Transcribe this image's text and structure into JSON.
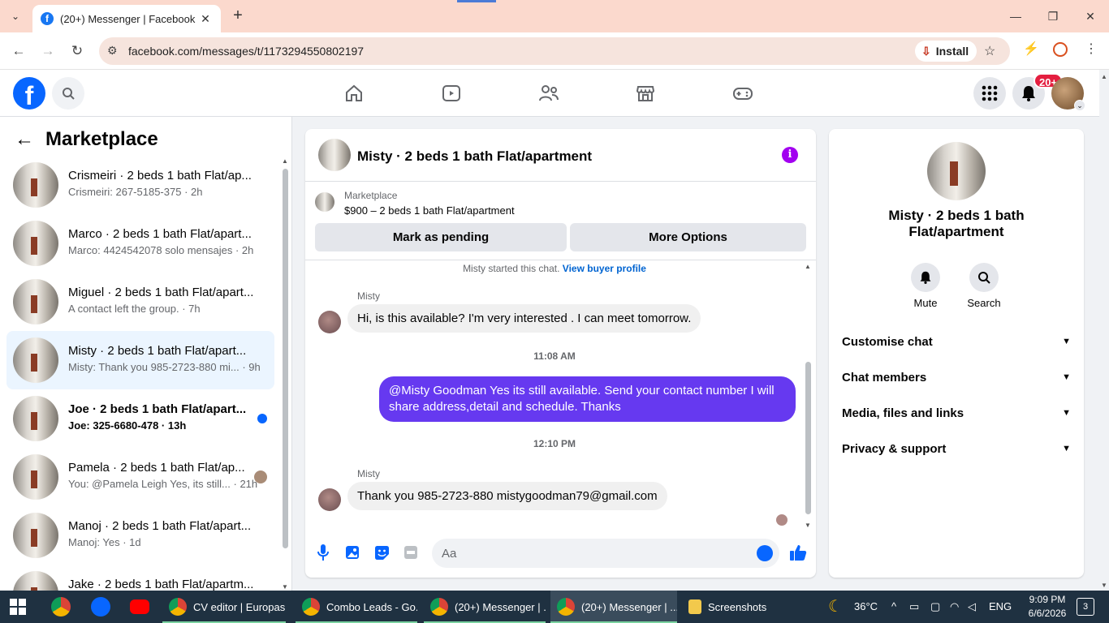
{
  "browser": {
    "tab_title": "(20+) Messenger | Facebook",
    "url": "facebook.com/messages/t/1173294550802197",
    "install_label": "Install"
  },
  "fb": {
    "notification_count": "20+"
  },
  "left": {
    "title": "Marketplace",
    "chats": [
      {
        "name": "Crismeiri · 2 beds 1 bath Flat/ap...",
        "preview": "Crismeiri: 267-5185-375 · 2h"
      },
      {
        "name": "Marco · 2 beds 1 bath Flat/apart...",
        "preview": "Marco: 4424542078 solo mensajes · 2h"
      },
      {
        "name": "Miguel · 2 beds 1 bath Flat/apart...",
        "preview": "A contact left the group. · 7h"
      },
      {
        "name": "Misty · 2 beds 1 bath Flat/apart...",
        "preview": "Misty: Thank you 985-2723-880 mi... · 9h"
      },
      {
        "name": "Joe · 2 beds 1 bath Flat/apart...",
        "preview": "Joe: 325-6680-478 · 13h"
      },
      {
        "name": "Pamela · 2 beds 1 bath Flat/ap...",
        "preview": "You: @Pamela Leigh Yes, its still... · 21h"
      },
      {
        "name": "Manoj · 2 beds 1 bath Flat/apart...",
        "preview": "Manoj: Yes · 1d"
      },
      {
        "name": "Jake · 2 beds 1 bath Flat/apartm...",
        "preview": ""
      }
    ]
  },
  "conversation": {
    "title": "Misty · 2 beds 1 bath Flat/apartment",
    "marketplace_label": "Marketplace",
    "listing": "$900 – 2 beds 1 bath Flat/apartment",
    "mark_pending": "Mark as pending",
    "more_options": "More Options",
    "started_text": "Misty started this chat.",
    "view_profile": "View buyer profile",
    "messages": [
      {
        "sender": "Misty",
        "text": "Hi, is this available? I'm very interested . I can meet tomorrow."
      },
      {
        "time": "11:08 AM"
      },
      {
        "text": "@Misty Goodman  Yes its still available. Send your contact number I will share address,detail and schedule. Thanks"
      },
      {
        "time": "12:10 PM"
      },
      {
        "sender": "Misty",
        "text": "Thank you 985-2723-880 mistygoodman79@gmail.com"
      }
    ],
    "composer_placeholder": "Aa"
  },
  "info_panel": {
    "name": "Misty · 2 beds 1 bath Flat/apartment",
    "mute": "Mute",
    "search": "Search",
    "sections": [
      "Customise chat",
      "Chat members",
      "Media, files and links",
      "Privacy & support"
    ]
  },
  "taskbar": {
    "apps": [
      {
        "label": "CV editor | Europas..."
      },
      {
        "label": "Combo Leads - Go..."
      },
      {
        "label": "(20+) Messenger | ..."
      },
      {
        "label": "(20+) Messenger | ..."
      },
      {
        "label": "Screenshots"
      }
    ],
    "weather": "36°C",
    "language": "ENG",
    "time": "9:09 PM",
    "date": "6/6/2026",
    "notifications": "3"
  },
  "colors": {
    "fb_blue": "#0866ff",
    "outgoing_bubble": "#6639f0",
    "info_icon": "#a200f0",
    "tab_strip": "#fbd9cd"
  }
}
